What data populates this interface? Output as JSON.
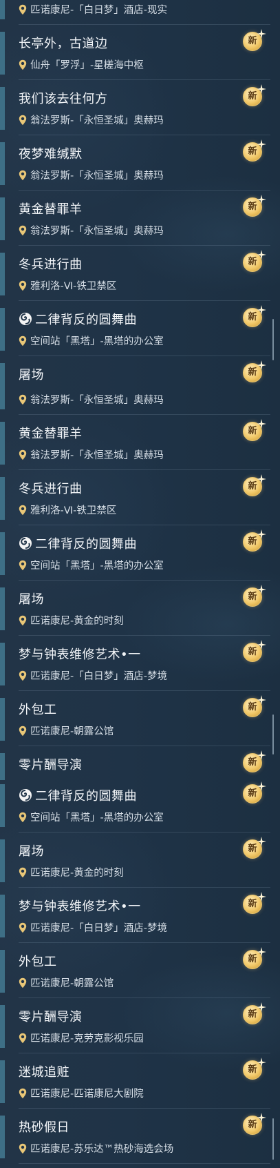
{
  "badge_label": "新",
  "colors": {
    "accent": "#3e6f86",
    "badge_gold": "#f2c96a",
    "pin": "#e9c777"
  },
  "panel1": {
    "top_location": "匹诺康尼-「白日梦」酒店-现实",
    "rows": [
      {
        "title": "长亭外，古道边",
        "location": "仙舟「罗浮」-星槎海中枢"
      },
      {
        "title": "我们该去往何方",
        "location": "翁法罗斯-「永恒圣城」奥赫玛"
      },
      {
        "title": "夜梦难缄默",
        "location": "翁法罗斯-「永恒圣城」奥赫玛"
      },
      {
        "title": "黄金替罪羊",
        "location": "翁法罗斯-「永恒圣城」奥赫玛"
      },
      {
        "title": "冬兵进行曲",
        "location": "雅利洛-Ⅵ-铁卫禁区"
      },
      {
        "title": "二律背反的圆舞曲",
        "location": "空间站「黑塔」-黑塔的办公室",
        "special": true
      },
      {
        "title": "屠场",
        "location": ""
      }
    ]
  },
  "panel2": {
    "top_location": "翁法罗斯-「永恒圣城」奥赫玛",
    "rows": [
      {
        "title": "黄金替罪羊",
        "location": "翁法罗斯-「永恒圣城」奥赫玛"
      },
      {
        "title": "冬兵进行曲",
        "location": "雅利洛-Ⅵ-铁卫禁区"
      },
      {
        "title": "二律背反的圆舞曲",
        "location": "空间站「黑塔」-黑塔的办公室",
        "special": true
      },
      {
        "title": "屠场",
        "location": "匹诺康尼-黄金的时刻"
      },
      {
        "title": "梦与钟表维修艺术•一",
        "location": "匹诺康尼-「白日梦」酒店-梦境"
      },
      {
        "title": "外包工",
        "location": "匹诺康尼-朝露公馆"
      },
      {
        "title": "零片酬导演",
        "location": ""
      }
    ]
  },
  "panel3": {
    "rows": [
      {
        "title": "二律背反的圆舞曲",
        "location": "空间站「黑塔」-黑塔的办公室",
        "special": true
      },
      {
        "title": "屠场",
        "location": "匹诺康尼-黄金的时刻"
      },
      {
        "title": "梦与钟表维修艺术•一",
        "location": "匹诺康尼-「白日梦」酒店-梦境"
      },
      {
        "title": "外包工",
        "location": "匹诺康尼-朝露公馆"
      },
      {
        "title": "零片酬导演",
        "location": "匹诺康尼-克劳克影视乐园"
      },
      {
        "title": "迷城追赃",
        "location": "匹诺康尼-匹诺康尼大剧院"
      },
      {
        "title": "热砂假日",
        "location": "匹诺康尼-苏乐达™热砂海选会场"
      }
    ]
  }
}
